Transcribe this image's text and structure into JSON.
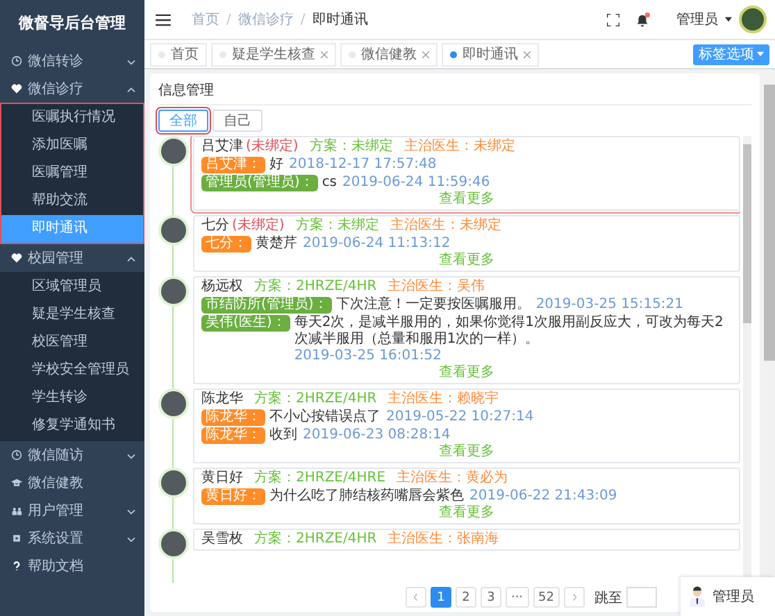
{
  "sidebar": {
    "title": "微督导后台管理",
    "items": [
      {
        "label": "微信转诊",
        "expanded": false
      },
      {
        "label": "微信诊疗",
        "expanded": true,
        "highlighted": true,
        "children": [
          {
            "label": "医嘱执行情况",
            "selected": false
          },
          {
            "label": "添加医嘱",
            "selected": false
          },
          {
            "label": "医嘱管理",
            "selected": false
          },
          {
            "label": "帮助交流",
            "selected": false
          },
          {
            "label": "即时通讯",
            "selected": true
          }
        ]
      },
      {
        "label": "校园管理",
        "expanded": true,
        "highlighted": false,
        "children": [
          {
            "label": "区域管理员",
            "selected": false
          },
          {
            "label": "疑是学生核查",
            "selected": false
          },
          {
            "label": "校医管理",
            "selected": false
          },
          {
            "label": "学校安全管理员",
            "selected": false
          },
          {
            "label": "学生转诊",
            "selected": false
          },
          {
            "label": "修复学通知书",
            "selected": false
          }
        ]
      },
      {
        "label": "微信随访",
        "expanded": false
      },
      {
        "label": "微信健教"
      },
      {
        "label": "用户管理",
        "expanded": false
      },
      {
        "label": "系统设置",
        "expanded": false
      },
      {
        "label": "帮助文档"
      }
    ]
  },
  "header": {
    "breadcrumb": [
      "首页",
      "微信诊疗",
      "即时通讯"
    ],
    "breadcrumb_separator": "/",
    "has_unread": true,
    "user": "管理员"
  },
  "tags": [
    {
      "label": "首页",
      "closable": false,
      "selected": false
    },
    {
      "label": "疑是学生核查",
      "closable": true,
      "selected": false
    },
    {
      "label": "微信健教",
      "closable": true,
      "selected": false
    },
    {
      "label": "即时通讯",
      "closable": true,
      "selected": true
    }
  ],
  "tag_options_button": "标签选项",
  "panel": {
    "title": "信息管理",
    "tabs": [
      {
        "label": "全部",
        "selected": true,
        "highlighted": true
      },
      {
        "label": "自己",
        "selected": false,
        "highlighted": false
      }
    ]
  },
  "conversations": [
    {
      "name": "吕艾津",
      "binding": "(未绑定)",
      "plan": "方案：未绑定",
      "doctor": "主治医生：未绑定",
      "highlighted": true,
      "messages": [
        {
          "sender": "吕艾津：",
          "kind": "patient",
          "text": "好",
          "time": "2018-12-17 17:57:48"
        },
        {
          "sender": "管理员(管理员)：",
          "kind": "staff",
          "text": "cs",
          "time": "2019-06-24 11:59:46"
        }
      ],
      "more": "查看更多"
    },
    {
      "name": "七分",
      "binding": "(未绑定)",
      "plan": "方案：未绑定",
      "doctor": "主治医生：未绑定",
      "highlighted": false,
      "messages": [
        {
          "sender": "七分：",
          "kind": "patient",
          "text": "黄楚芹",
          "time": "2019-06-24 11:13:12"
        }
      ],
      "more": "查看更多"
    },
    {
      "name": "杨远权",
      "plan": "方案：2HRZE/4HR",
      "doctor": "主治医生：吴伟",
      "highlighted": false,
      "messages": [
        {
          "sender": "市结防所(管理员)：",
          "kind": "staff",
          "text": "下次注意！一定要按医嘱服用。",
          "time": "2019-03-25 15:15:21"
        },
        {
          "sender": "吴伟(医生)：",
          "kind": "staff",
          "text": "每天2次，是减半服用的，如果你觉得1次服用副反应大，可改为每天2次减半服用（总量和服用1次的一样）。",
          "time": "2019-03-25 16:01:52"
        }
      ],
      "more": "查看更多"
    },
    {
      "name": "陈龙华",
      "plan": "方案：2HRZE/4HR",
      "doctor": "主治医生：赖晓宇",
      "highlighted": false,
      "messages": [
        {
          "sender": "陈龙华：",
          "kind": "patient",
          "text": "不小心按错误点了",
          "time": "2019-05-22 10:27:14"
        },
        {
          "sender": "陈龙华：",
          "kind": "patient",
          "text": "收到",
          "time": "2019-06-23 08:28:14"
        }
      ],
      "more": "查看更多"
    },
    {
      "name": "黄日好",
      "plan": "方案：2HRZE/4HRE",
      "doctor": "主治医生：黄必为",
      "highlighted": false,
      "messages": [
        {
          "sender": "黄日好：",
          "kind": "patient",
          "text": "为什么吃了肺结核药嘴唇会紫色",
          "time": "2019-06-22 21:43:09"
        }
      ],
      "more": "查看更多"
    },
    {
      "name": "吴雪枚",
      "plan": "方案：2HRZE/4HR",
      "doctor": "主治医生：张南海",
      "highlighted": false
    }
  ],
  "pagination": {
    "pages": [
      {
        "label": "1",
        "selected": true
      },
      {
        "label": "2",
        "selected": false
      },
      {
        "label": "3",
        "selected": false
      },
      {
        "label": "···",
        "selected": false
      },
      {
        "label": "52",
        "selected": false
      }
    ],
    "jump_label": "跳至"
  },
  "floating_user": {
    "label": "管理员"
  }
}
